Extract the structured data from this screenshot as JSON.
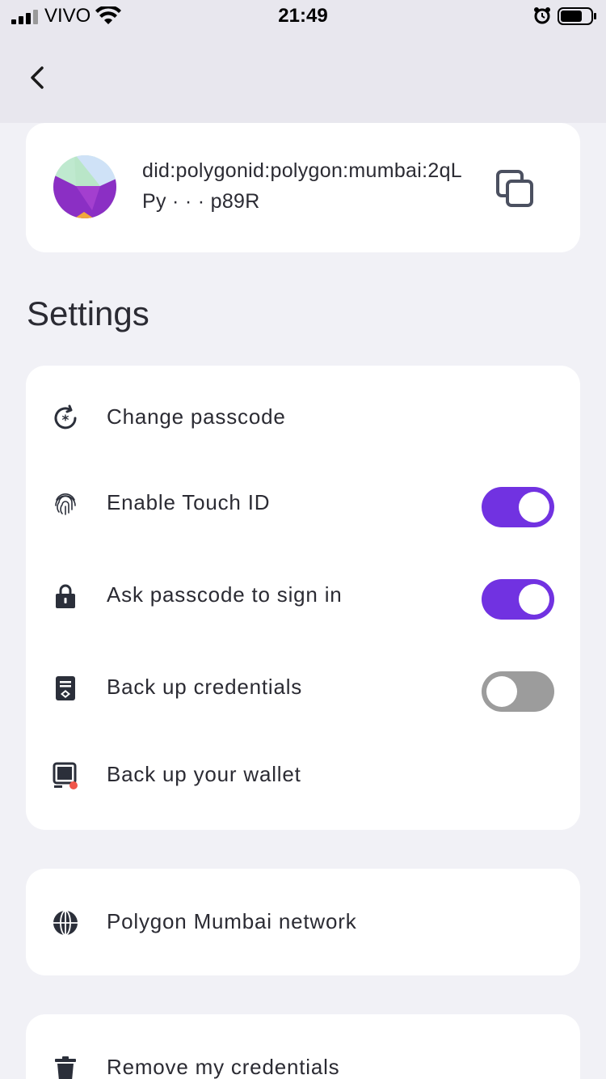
{
  "status_bar": {
    "carrier": "VIVO",
    "time": "21:49"
  },
  "nav": {
    "back_icon": "chevron-left-icon"
  },
  "identity": {
    "did_text": "did:polygonid:polygon:mumbai:2qLPy · · · p89R",
    "copy_icon": "copy-icon"
  },
  "settings": {
    "title": "Settings",
    "items": [
      {
        "label": "Change passcode",
        "icon": "passcode-icon"
      },
      {
        "label": "Enable Touch ID",
        "icon": "fingerprint-icon",
        "toggle": true
      },
      {
        "label": "Ask passcode to sign in",
        "icon": "lock-icon",
        "toggle": true
      },
      {
        "label": "Back up credentials",
        "icon": "backup-icon",
        "toggle": false
      },
      {
        "label": "Back up your wallet",
        "icon": "wallet-icon"
      }
    ]
  },
  "network": {
    "label": "Polygon Mumbai network",
    "icon": "globe-icon"
  },
  "danger": {
    "label": "Remove my credentials",
    "icon": "trash-icon"
  },
  "colors": {
    "accent": "#7132e1",
    "toggle_off": "#9c9c9c",
    "background": "#f1f1f6",
    "card": "#ffffff"
  }
}
